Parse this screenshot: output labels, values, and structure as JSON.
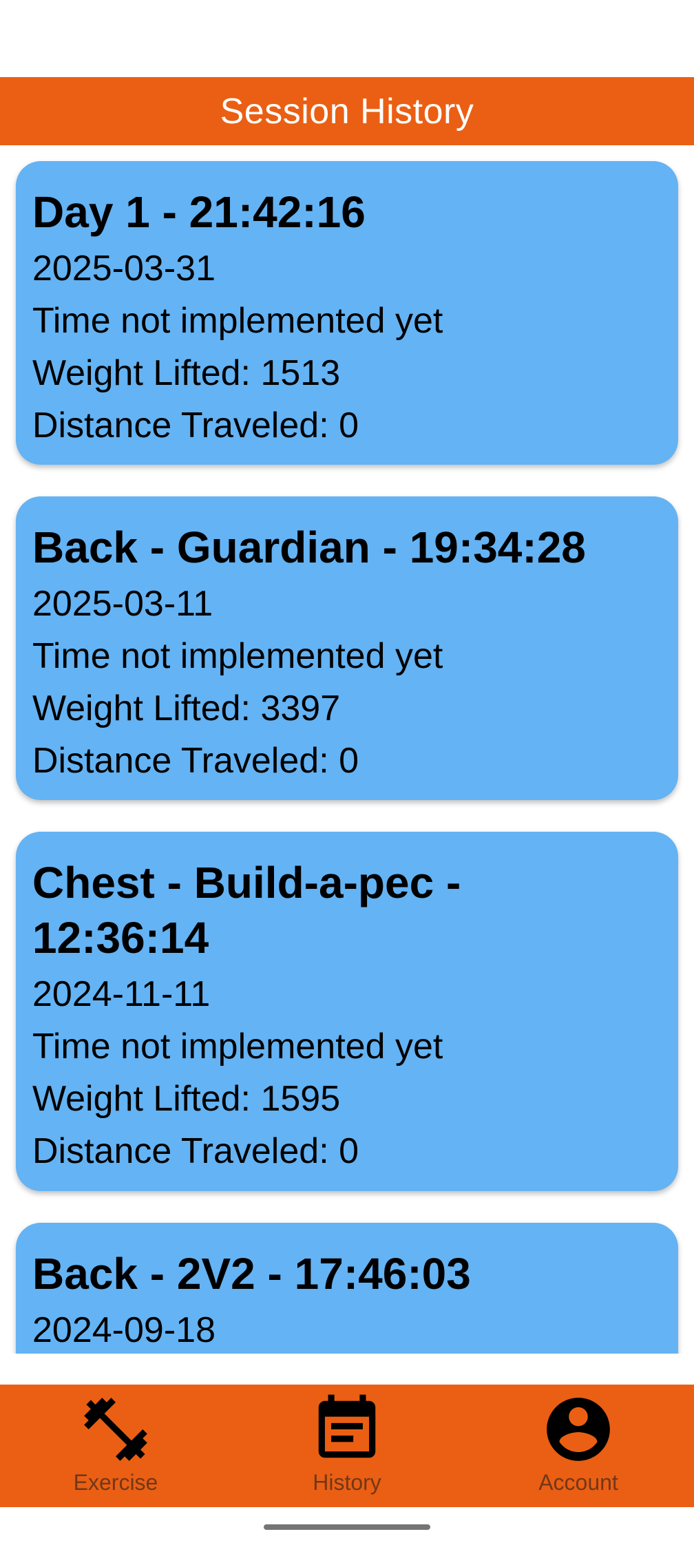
{
  "header": {
    "title": "Session History"
  },
  "sessions": [
    {
      "title": "Day 1 - 21:42:16",
      "date": "2025-03-31",
      "time": "Time not implemented yet",
      "weight": "Weight Lifted: 1513",
      "distance": "Distance Traveled: 0"
    },
    {
      "title": "Back - Guardian - 19:34:28",
      "date": "2025-03-11",
      "time": "Time not implemented yet",
      "weight": "Weight Lifted: 3397",
      "distance": "Distance Traveled: 0"
    },
    {
      "title": "Chest - Build-a-pec - 12:36:14",
      "date": "2024-11-11",
      "time": "Time not implemented yet",
      "weight": "Weight Lifted: 1595",
      "distance": "Distance Traveled: 0"
    },
    {
      "title": "Back - 2V2 - 17:46:03",
      "date": "2024-09-18"
    }
  ],
  "nav": {
    "items": [
      {
        "label": "Exercise",
        "icon": "dumbbell-icon"
      },
      {
        "label": "History",
        "icon": "event-note-icon"
      },
      {
        "label": "Account",
        "icon": "account-circle-icon"
      }
    ]
  },
  "colors": {
    "accent": "#ea5f13",
    "card": "#64b3f4"
  }
}
